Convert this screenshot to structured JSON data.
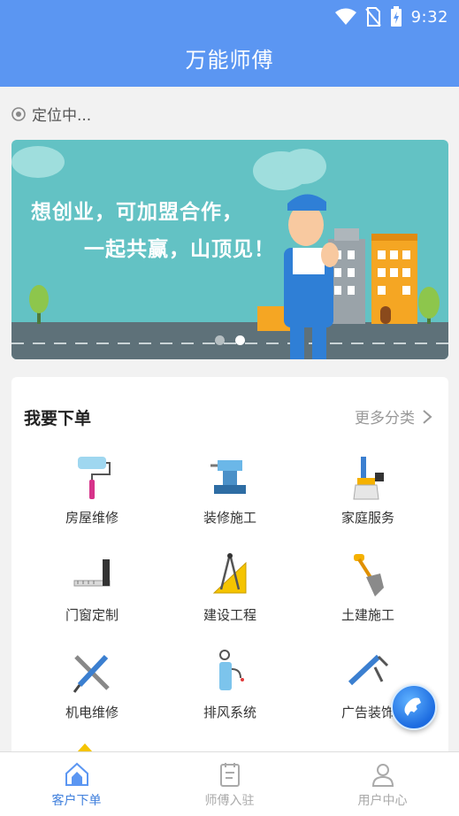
{
  "status": {
    "time": "9:32"
  },
  "header": {
    "title": "万能师傅"
  },
  "location": {
    "text": "定位中..."
  },
  "banner": {
    "line1": "想创业，可加盟合作，",
    "line2": "一起共赢，山顶见！",
    "slide_count": 2,
    "active_slide": 2
  },
  "order_section": {
    "title": "我要下单",
    "more_label": "更多分类",
    "items": [
      {
        "label": "房屋维修",
        "icon": "paint-roller-icon"
      },
      {
        "label": "装修施工",
        "icon": "vise-icon"
      },
      {
        "label": "家庭服务",
        "icon": "cleaning-brush-icon"
      },
      {
        "label": "门窗定制",
        "icon": "ruler-square-icon"
      },
      {
        "label": "建设工程",
        "icon": "drafting-compass-icon"
      },
      {
        "label": "土建施工",
        "icon": "shovel-icon"
      },
      {
        "label": "机电维修",
        "icon": "screwdriver-wrench-icon"
      },
      {
        "label": "排风系统",
        "icon": "sprayer-tank-icon"
      },
      {
        "label": "广告装饰",
        "icon": "caulking-gun-icon"
      }
    ]
  },
  "tabs": [
    {
      "label": "客户下单",
      "icon": "house-icon",
      "active": true
    },
    {
      "label": "师傅入驻",
      "icon": "clipboard-icon",
      "active": false
    },
    {
      "label": "用户中心",
      "icon": "user-icon",
      "active": false
    }
  ],
  "colors": {
    "primary": "#5b96f2",
    "active_tab": "#3f7fdc",
    "banner_bg": "#63c2c4"
  }
}
